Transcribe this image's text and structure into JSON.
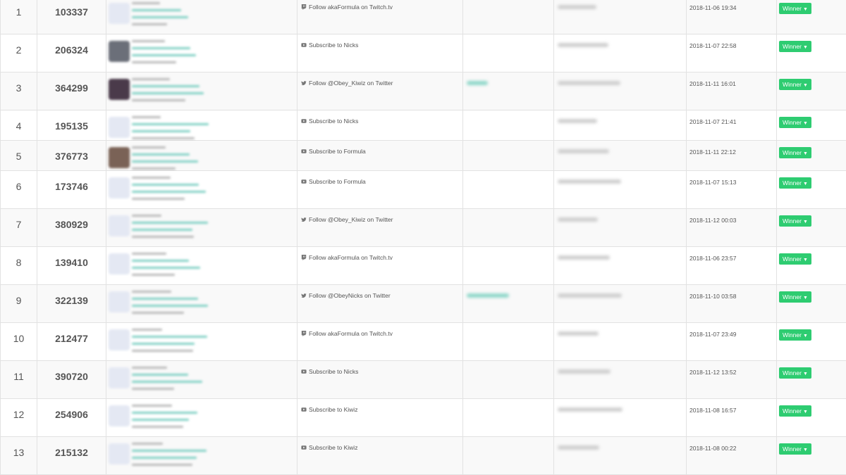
{
  "entries": [
    {
      "rank": "1",
      "entry_id": "103337",
      "action": "Follow akaFormula on Twitch.tv",
      "action_icon": "twitch-icon",
      "date": "2018-11-06 19:34",
      "status": "Winner",
      "avatar": "placeholder",
      "answer_visible": false,
      "row_height": 54
    },
    {
      "rank": "2",
      "entry_id": "206324",
      "action": "Subscribe to Nicks",
      "action_icon": "youtube-icon",
      "date": "2018-11-07 22:58",
      "status": "Winner",
      "avatar": "photo",
      "answer_visible": false,
      "row_height": 54
    },
    {
      "rank": "3",
      "entry_id": "364299",
      "action": "Follow @Obey_Kiwiz on Twitter",
      "action_icon": "twitter-icon",
      "date": "2018-11-11 16:01",
      "status": "Winner",
      "avatar": "photo-dark",
      "answer_visible": true,
      "row_height": 54
    },
    {
      "rank": "4",
      "entry_id": "195135",
      "action": "Subscribe to Nicks",
      "action_icon": "youtube-icon",
      "date": "2018-11-07 21:41",
      "status": "Winner",
      "avatar": "placeholder",
      "answer_visible": false,
      "row_height": 43
    },
    {
      "rank": "5",
      "entry_id": "376773",
      "action": "Subscribe to Formula",
      "action_icon": "youtube-icon",
      "date": "2018-11-11 22:12",
      "status": "Winner",
      "avatar": "photo-brown",
      "answer_visible": false,
      "row_height": 43
    },
    {
      "rank": "6",
      "entry_id": "173746",
      "action": "Subscribe to Formula",
      "action_icon": "youtube-icon",
      "date": "2018-11-07 15:13",
      "status": "Winner",
      "avatar": "placeholder",
      "answer_visible": false,
      "row_height": 43
    },
    {
      "rank": "7",
      "entry_id": "380929",
      "action": "Follow @Obey_Kiwiz on Twitter",
      "action_icon": "twitter-icon",
      "date": "2018-11-12 00:03",
      "status": "Winner",
      "avatar": "placeholder",
      "answer_visible": false,
      "row_height": 54
    },
    {
      "rank": "8",
      "entry_id": "139410",
      "action": "Follow akaFormula on Twitch.tv",
      "action_icon": "twitch-icon",
      "date": "2018-11-06 23:57",
      "status": "Winner",
      "avatar": "placeholder",
      "answer_visible": false,
      "row_height": 54
    },
    {
      "rank": "9",
      "entry_id": "322139",
      "action": "Follow @ObeyNicks on Twitter",
      "action_icon": "twitter-icon",
      "date": "2018-11-10 03:58",
      "status": "Winner",
      "avatar": "placeholder",
      "answer_visible": true,
      "row_height": 54
    },
    {
      "rank": "10",
      "entry_id": "212477",
      "action": "Follow akaFormula on Twitch.tv",
      "action_icon": "twitch-icon",
      "date": "2018-11-07 23:49",
      "status": "Winner",
      "avatar": "placeholder",
      "answer_visible": false,
      "row_height": 54
    },
    {
      "rank": "11",
      "entry_id": "390720",
      "action": "Subscribe to Nicks",
      "action_icon": "youtube-icon",
      "date": "2018-11-12 13:52",
      "status": "Winner",
      "avatar": "placeholder",
      "answer_visible": false,
      "row_height": 54
    },
    {
      "rank": "12",
      "entry_id": "254906",
      "action": "Subscribe to Kiwiz",
      "action_icon": "youtube-icon",
      "date": "2018-11-08 16:57",
      "status": "Winner",
      "avatar": "placeholder",
      "answer_visible": false,
      "row_height": 54
    },
    {
      "rank": "13",
      "entry_id": "215132",
      "action": "Subscribe to Kiwiz",
      "action_icon": "youtube-icon",
      "date": "2018-11-08 00:22",
      "status": "Winner",
      "avatar": "placeholder",
      "answer_visible": false,
      "row_height": 54
    }
  ],
  "colors": {
    "winner_button": "#2ecc71",
    "row_alt": "#f9f9f9",
    "border": "#e2e2e2",
    "blurred_link": "#7fd0c4"
  }
}
